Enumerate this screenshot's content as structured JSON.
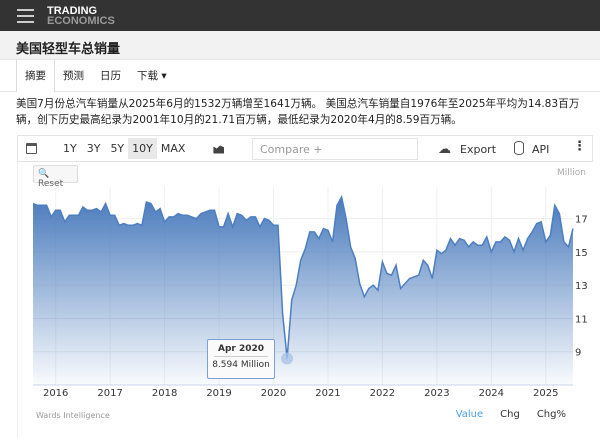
{
  "header": {
    "logo_line1": "TRADING",
    "logo_line2": "ECONOMICS"
  },
  "page_title": "美国轻型车总销量",
  "tabs": [
    {
      "label": "摘要"
    },
    {
      "label": "预测"
    },
    {
      "label": "日历"
    },
    {
      "label": "下载 ▾"
    }
  ],
  "description": "美国7月份总汽车销量从2025年6月的1532万辆增至1641万辆。 美国总汽车销量自1976年至2025年平均为14.83百万辆，创下历史最高纪录为2001年10月的21.71百万辆，最低纪录为2020年4月的8.59百万辆。",
  "toolbar": {
    "ranges": [
      "1Y",
      "3Y",
      "5Y",
      "10Y",
      "MAX"
    ],
    "selected": "10Y",
    "compare_placeholder": "Compare +",
    "export": "Export",
    "api": "API"
  },
  "chart": {
    "reset": "Reset",
    "unit": "Million",
    "tooltip_date": "Apr 2020",
    "tooltip_value": "8.594 Million",
    "source": "Wards Intelligence",
    "modes": [
      "Value",
      "Chg",
      "Chg%"
    ],
    "active_mode": "Value"
  },
  "colors": {
    "line": "#4d7fc0",
    "fill_top": "#4a7bbd",
    "accent": "#4a9fe0"
  },
  "chart_data": {
    "type": "area",
    "ylabel": "Million",
    "ylim": [
      7,
      18.9
    ],
    "yticks": [
      9,
      11,
      13,
      15,
      17
    ],
    "xticks": [
      "2016",
      "2017",
      "2018",
      "2019",
      "2020",
      "2021",
      "2022",
      "2023",
      "2024",
      "2025"
    ],
    "grid": true,
    "x": [
      "2015-08",
      "2015-09",
      "2015-10",
      "2015-11",
      "2015-12",
      "2016-01",
      "2016-02",
      "2016-03",
      "2016-04",
      "2016-05",
      "2016-06",
      "2016-07",
      "2016-08",
      "2016-09",
      "2016-10",
      "2016-11",
      "2016-12",
      "2017-01",
      "2017-02",
      "2017-03",
      "2017-04",
      "2017-05",
      "2017-06",
      "2017-07",
      "2017-08",
      "2017-09",
      "2017-10",
      "2017-11",
      "2017-12",
      "2018-01",
      "2018-02",
      "2018-03",
      "2018-04",
      "2018-05",
      "2018-06",
      "2018-07",
      "2018-08",
      "2018-09",
      "2018-10",
      "2018-11",
      "2018-12",
      "2019-01",
      "2019-02",
      "2019-03",
      "2019-04",
      "2019-05",
      "2019-06",
      "2019-07",
      "2019-08",
      "2019-09",
      "2019-10",
      "2019-11",
      "2019-12",
      "2020-01",
      "2020-02",
      "2020-03",
      "2020-04",
      "2020-05",
      "2020-06",
      "2020-07",
      "2020-08",
      "2020-09",
      "2020-10",
      "2020-11",
      "2020-12",
      "2021-01",
      "2021-02",
      "2021-03",
      "2021-04",
      "2021-05",
      "2021-06",
      "2021-07",
      "2021-08",
      "2021-09",
      "2021-10",
      "2021-11",
      "2021-12",
      "2022-01",
      "2022-02",
      "2022-03",
      "2022-04",
      "2022-05",
      "2022-06",
      "2022-07",
      "2022-08",
      "2022-09",
      "2022-10",
      "2022-11",
      "2022-12",
      "2023-01",
      "2023-02",
      "2023-03",
      "2023-04",
      "2023-05",
      "2023-06",
      "2023-07",
      "2023-08",
      "2023-09",
      "2023-10",
      "2023-11",
      "2023-12",
      "2024-01",
      "2024-02",
      "2024-03",
      "2024-04",
      "2024-05",
      "2024-06",
      "2024-07",
      "2024-08",
      "2024-09",
      "2024-10",
      "2024-11",
      "2024-12",
      "2025-01",
      "2025-02",
      "2025-03",
      "2025-04",
      "2025-05",
      "2025-06",
      "2025-07"
    ],
    "values": [
      17.9,
      17.8,
      17.8,
      17.8,
      17.1,
      17.5,
      17.5,
      16.8,
      17.2,
      17.2,
      17.2,
      17.7,
      17.5,
      17.5,
      17.6,
      17.4,
      17.9,
      17.2,
      17.2,
      16.6,
      16.7,
      16.6,
      16.6,
      16.7,
      16.6,
      18.0,
      17.9,
      17.4,
      17.6,
      16.8,
      17.1,
      17.1,
      17.3,
      17.2,
      17.2,
      17.1,
      17.0,
      17.3,
      17.4,
      17.5,
      17.5,
      16.5,
      16.5,
      17.3,
      16.5,
      17.3,
      17.2,
      16.9,
      17.1,
      17.1,
      16.5,
      17.0,
      16.9,
      16.6,
      16.6,
      11.3,
      8.594,
      12.1,
      13.0,
      14.5,
      15.2,
      16.2,
      16.2,
      15.8,
      16.4,
      16.3,
      15.6,
      17.8,
      18.3,
      17.0,
      15.3,
      14.6,
      13.1,
      12.3,
      12.8,
      13.0,
      12.7,
      14.4,
      13.7,
      13.6,
      14.2,
      12.8,
      13.1,
      13.4,
      13.5,
      13.6,
      14.5,
      14.2,
      13.4,
      15.1,
      14.9,
      15.1,
      15.8,
      15.4,
      15.8,
      15.7,
      15.3,
      15.6,
      15.4,
      15.4,
      15.9,
      15.0,
      15.6,
      15.6,
      15.9,
      15.7,
      15.0,
      15.8,
      15.1,
      15.8,
      16.2,
      16.7,
      16.8,
      15.6,
      16.0,
      17.8,
      17.3,
      15.6,
      15.3,
      16.4
    ]
  }
}
